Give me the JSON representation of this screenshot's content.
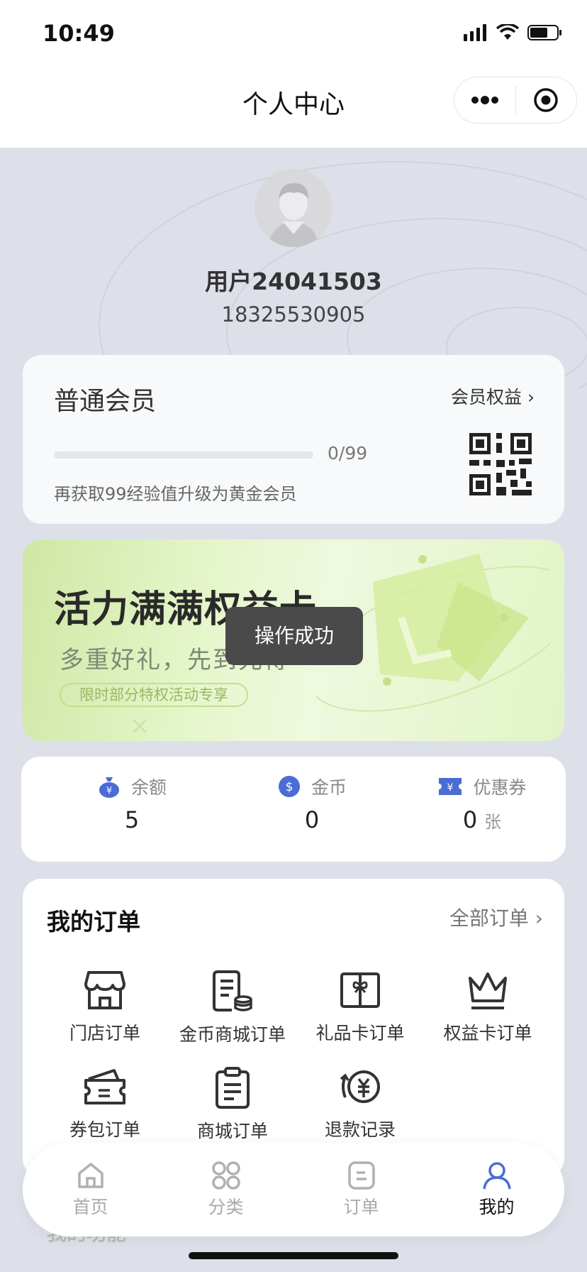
{
  "status": {
    "time": "10:49"
  },
  "navbar": {
    "title": "个人中心"
  },
  "profile": {
    "username": "用户24041503",
    "phone": "18325530905"
  },
  "member": {
    "level": "普通会员",
    "benefits_link": "会员权益 ›",
    "progress_text": "0/99",
    "progress_fraction": 0,
    "upgrade_tip": "再获取99经验值升级为黄金会员"
  },
  "banner": {
    "title": "活力满满权益卡",
    "subtitle": "多重好礼，先到先得",
    "pill": "限时部分特权活动专享"
  },
  "toast": "操作成功",
  "assets": [
    {
      "label": "余额",
      "value": "5",
      "unit": "",
      "icon": "money-bag-icon",
      "color": "#4a6cd4"
    },
    {
      "label": "金币",
      "value": "0",
      "unit": "",
      "icon": "coin-icon",
      "color": "#4a6cd4"
    },
    {
      "label": "优惠券",
      "value": "0",
      "unit": "张",
      "icon": "coupon-icon",
      "color": "#4a6cd4"
    }
  ],
  "orders": {
    "title": "我的订单",
    "all_link": "全部订单 ›",
    "items": [
      {
        "label": "门店订单",
        "icon": "store-icon"
      },
      {
        "label": "金币商城订单",
        "icon": "coin-mall-icon"
      },
      {
        "label": "礼品卡订单",
        "icon": "gift-card-icon"
      },
      {
        "label": "权益卡订单",
        "icon": "crown-icon"
      },
      {
        "label": "券包订单",
        "icon": "wallet-icon"
      },
      {
        "label": "商城订单",
        "icon": "clipboard-icon"
      },
      {
        "label": "退款记录",
        "icon": "refund-icon"
      }
    ]
  },
  "behind_section": "我的功能",
  "tabbar": {
    "items": [
      {
        "label": "首页",
        "icon": "home-icon",
        "active": false
      },
      {
        "label": "分类",
        "icon": "category-icon",
        "active": false
      },
      {
        "label": "订单",
        "icon": "order-icon",
        "active": false
      },
      {
        "label": "我的",
        "icon": "user-icon",
        "active": true
      }
    ]
  },
  "colors": {
    "accent": "#4a6cd4",
    "banner_green": "#cfe7a4",
    "background": "#dde0e8"
  }
}
